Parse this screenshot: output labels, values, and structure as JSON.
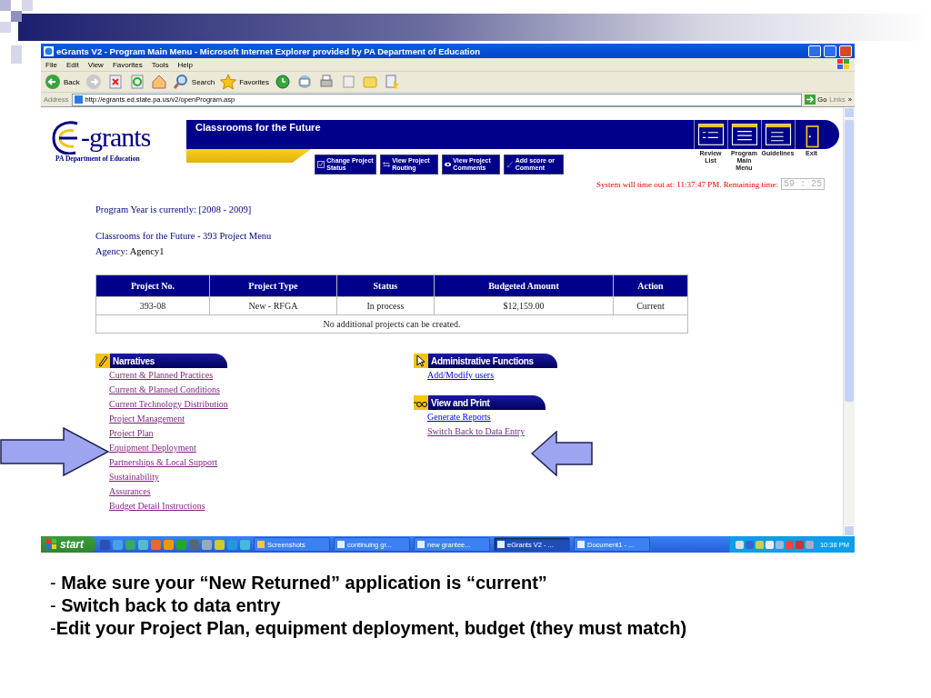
{
  "window": {
    "title": "eGrants V2 - Program Main Menu - Microsoft Internet Explorer provided by PA Department of Education",
    "menu": [
      "File",
      "Edit",
      "View",
      "Favorites",
      "Tools",
      "Help"
    ],
    "toolbar": [
      {
        "kind": "back",
        "label": "Back"
      },
      {
        "kind": "forward"
      },
      {
        "kind": "stop"
      },
      {
        "kind": "refresh"
      },
      {
        "kind": "home"
      },
      {
        "kind": "search",
        "label": "Search"
      },
      {
        "kind": "favorites",
        "label": "Favorites"
      },
      {
        "kind": "history"
      },
      {
        "kind": "mail"
      },
      {
        "kind": "print"
      },
      {
        "kind": "edit"
      },
      {
        "kind": "folder"
      },
      {
        "kind": "research"
      }
    ],
    "address": {
      "label": "Address",
      "value": "http://egrants.ed.state.pa.us/v2/openProgram.asp"
    },
    "go": "Go",
    "links": "Links",
    "links_more": "»"
  },
  "page": {
    "logo": {
      "text": "-grants",
      "subtitle": "PA Department of Education"
    },
    "banner_title": "Classrooms for the Future",
    "action_buttons": [
      {
        "kind": "check",
        "label": "Change Project Status"
      },
      {
        "kind": "routing",
        "label": "View Project Routing"
      },
      {
        "kind": "eye",
        "label": "View Project Comments"
      },
      {
        "kind": "pen",
        "label": "Add score or Comment"
      }
    ],
    "nav": [
      {
        "kind": "list",
        "label": "Review List"
      },
      {
        "kind": "menu",
        "label": "Program Main Menu"
      },
      {
        "kind": "guide",
        "label": "Guidelines"
      },
      {
        "kind": "exit",
        "label": "Exit"
      }
    ],
    "timeout": {
      "text": "System will time out at: 11:37:47 PM. Remaining time:",
      "remaining": "59 : 25"
    },
    "program_year": "Program Year is currently: [2008 - 2009]",
    "menu_title": "Classrooms for the Future - 393 Project Menu",
    "agency": {
      "label": "Agency:",
      "value": "Agency1"
    },
    "table": {
      "columns": [
        "Project No.",
        "Project Type",
        "Status",
        "Budgeted Amount",
        "Action"
      ],
      "rows": [
        [
          "393-08",
          "New - RFGA",
          "In process",
          "$12,159.00",
          "Current"
        ]
      ],
      "note": "No additional projects can be created."
    },
    "sections": [
      {
        "kind": "pencil",
        "title": "Narratives",
        "links": [
          {
            "label": "Current & Planned Practices",
            "visited": true
          },
          {
            "label": "Current & Planned Conditions",
            "visited": true
          },
          {
            "label": "Current Technology Distribution",
            "visited": true
          },
          {
            "label": "Project Management",
            "visited": true
          },
          {
            "label": "Project Plan",
            "visited": true
          },
          {
            "label": "Equipment Deployment",
            "visited": true
          },
          {
            "label": "Partnerships & Local Support",
            "visited": true
          },
          {
            "label": "Sustainability",
            "visited": true
          },
          {
            "label": "Assurances",
            "visited": true
          },
          {
            "label": "Budget Detail Instructions",
            "visited": true
          }
        ]
      },
      {
        "kind": "cursor",
        "title": "Administrative Functions",
        "links": [
          {
            "label": "Add/Modify users",
            "visited": false
          }
        ]
      },
      {
        "kind": "glasses",
        "title": "View and Print",
        "links": [
          {
            "label": "Generate Reports",
            "visited": false
          },
          {
            "label": "Switch Back to Data Entry",
            "visited": true
          }
        ]
      }
    ]
  },
  "taskbar": {
    "start": "start",
    "tasks": [
      {
        "label": "Screenshots",
        "selected": false
      },
      {
        "label": "continuing gr...",
        "selected": false
      },
      {
        "label": "new grantee...",
        "selected": false
      },
      {
        "label": "eGrants V2 - ...",
        "selected": true
      },
      {
        "label": "Document1 - ...",
        "selected": false
      }
    ],
    "clock": "10:38 PM"
  },
  "notes": [
    "- **Make sure your “New Returned” application is “current”**",
    "- **Switch back to data entry**",
    "-**Edit your Project Plan, equipment deployment, budget (they must match)**"
  ]
}
